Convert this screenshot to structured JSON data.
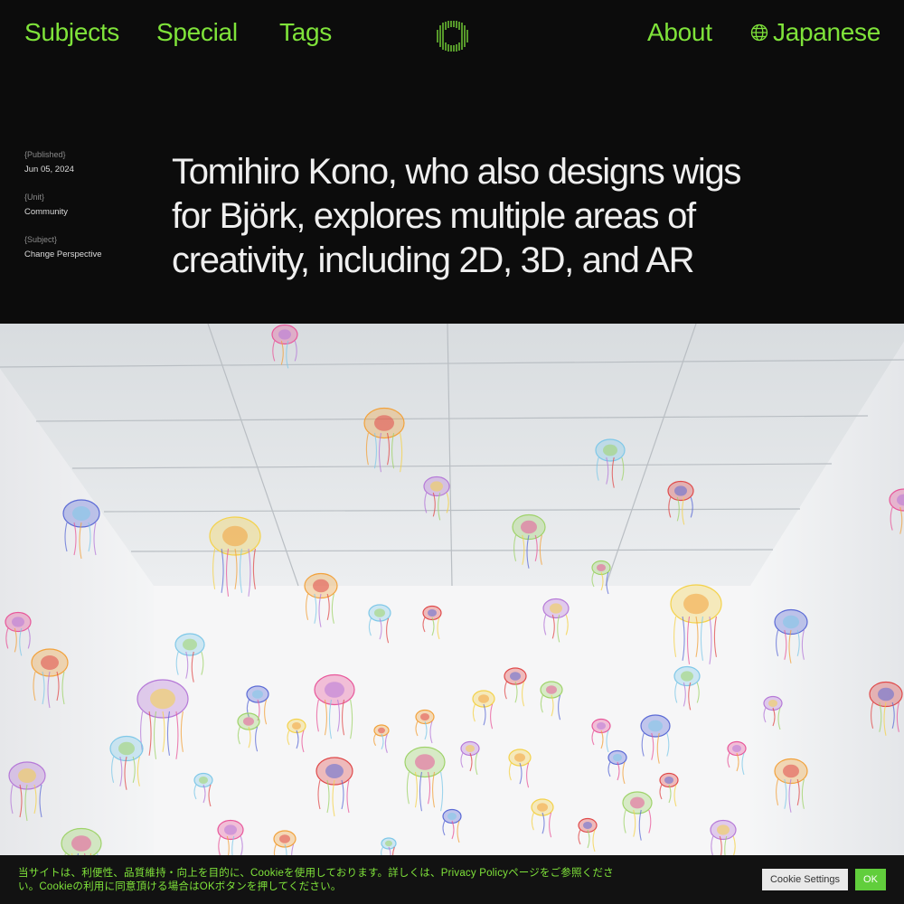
{
  "nav": {
    "subjects": "Subjects",
    "special": "Special",
    "tags": "Tags",
    "about": "About",
    "language": "Japanese",
    "accent_color": "#7fe33a",
    "logo_icon": "green-radial-lines-logo",
    "language_icon": "globe-icon"
  },
  "article": {
    "meta": {
      "published_label": "{Published}",
      "published_value": "Jun 05, 2024",
      "unit_label": "{Unit}",
      "unit_value": "Community",
      "subject_label": "{Subject}",
      "subject_value": "Change Perspective"
    },
    "title": "Tomihiro Kono, who also designs wigs for Björk, explores multiple areas of creativity, including 2D, 3D, and AR"
  },
  "cookie": {
    "text_before": "当サイトは、利便性、品質維持・向上を目的に、Cookieを使用しております。詳しくは、",
    "policy_link": "Privacy Policy",
    "text_after": "ページをご参照ください。Cookieの利用に同意頂ける場合はOKボタンを押してください。",
    "settings_label": "Cookie Settings",
    "ok_label": "OK",
    "ok_color": "#61ce3c"
  }
}
